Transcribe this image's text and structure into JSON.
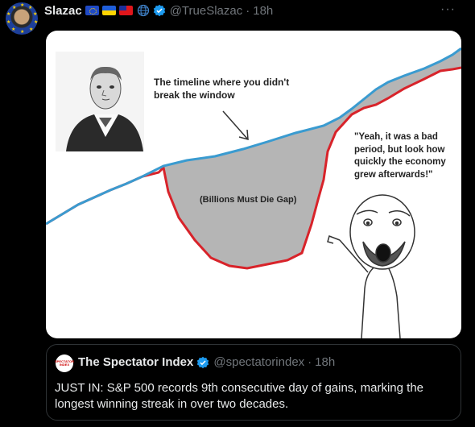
{
  "tweet": {
    "author_name": "Slazac",
    "author_handle": "@TrueSlazac",
    "separator": "·",
    "timestamp": "18h",
    "more_label": "···",
    "author_icons": [
      "eu-flag-icon",
      "ukraine-flag-icon",
      "taiwan-flag-icon",
      "globe-icon",
      "verified-badge-icon"
    ]
  },
  "meme": {
    "label_top": "The timeline where you didn't break the window",
    "label_wojak": "\"Yeah, it was a bad period, but look how quickly the economy grew afterwards!\"",
    "label_gap": "(Billions Must Die Gap)",
    "colors": {
      "blue_line": "#3a9bd0",
      "red_line": "#d8232a",
      "gap_fill": "#b5b5b5"
    }
  },
  "quoted_tweet": {
    "author_name": "The Spectator Index",
    "author_handle": "@spectatorindex",
    "separator": "·",
    "timestamp": "18h",
    "avatar_text": "SPECTATOR INDEX",
    "text": "JUST IN: S&P 500 records 9th consecutive day of gains, marking the longest winning streak in over two decades."
  },
  "colors": {
    "background": "#000000",
    "text": "#e7e9ea",
    "muted": "#71767b",
    "verified_blue": "#1d9bf0",
    "border": "#2f3336"
  }
}
